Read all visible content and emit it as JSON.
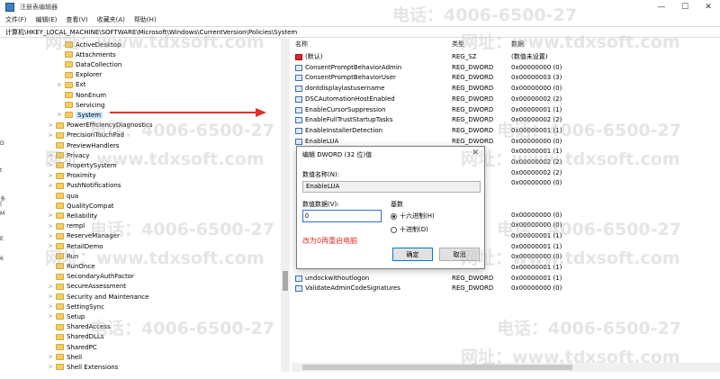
{
  "window": {
    "title": "注册表编辑器",
    "minimize": "—",
    "maximize": "☐",
    "close": "✕"
  },
  "menu": [
    "文件(F)",
    "编辑(E)",
    "查看(V)",
    "收藏夹(A)",
    "帮助(H)"
  ],
  "address": "计算机\\HKEY_LOCAL_MACHINE\\SOFTWARE\\Microsoft\\Windows\\CurrentVersion\\Policies\\System",
  "tree": {
    "items": [
      {
        "label": "ActiveDesktop",
        "expander": ""
      },
      {
        "label": "Attachments",
        "expander": ""
      },
      {
        "label": "DataCollection",
        "expander": ""
      },
      {
        "label": "Explorer",
        "expander": ""
      },
      {
        "label": "Ext",
        "expander": ">"
      },
      {
        "label": "NonEnum",
        "expander": ""
      },
      {
        "label": "Servicing",
        "expander": ""
      },
      {
        "label": "System",
        "expander": ">"
      },
      {
        "label": "PowerEfficiencyDiagnostics",
        "expander": ">"
      },
      {
        "label": "PrecisionTouchPad",
        "expander": ">"
      },
      {
        "label": "PreviewHandlers",
        "expander": ""
      },
      {
        "label": "Privacy",
        "expander": ">"
      },
      {
        "label": "PropertySystem",
        "expander": ">"
      },
      {
        "label": "Proximity",
        "expander": ">"
      },
      {
        "label": "PushNotifications",
        "expander": ">"
      },
      {
        "label": "qua",
        "expander": ""
      },
      {
        "label": "QualityCompat",
        "expander": ""
      },
      {
        "label": "Reliability",
        "expander": ">"
      },
      {
        "label": "rempl",
        "expander": ">"
      },
      {
        "label": "ReserveManager",
        "expander": ">"
      },
      {
        "label": "RetailDemo",
        "expander": ">"
      },
      {
        "label": "Run",
        "expander": ""
      },
      {
        "label": "RunOnce",
        "expander": ""
      },
      {
        "label": "SecondaryAuthFactor",
        "expander": ""
      },
      {
        "label": "SecureAssessment",
        "expander": ">"
      },
      {
        "label": "Security and Maintenance",
        "expander": ">"
      },
      {
        "label": "SettingSync",
        "expander": ">"
      },
      {
        "label": "Setup",
        "expander": ">"
      },
      {
        "label": "SharedAccess",
        "expander": ""
      },
      {
        "label": "SharedDLLs",
        "expander": ""
      },
      {
        "label": "SharedPC",
        "expander": ""
      },
      {
        "label": "Shell",
        "expander": ">"
      },
      {
        "label": "Shell Extensions",
        "expander": ">"
      },
      {
        "label": "ShellCompatibility",
        "expander": ">"
      }
    ],
    "selected_index": 7
  },
  "left_edge_chars": [
    "D",
    "t",
    "多",
    "(",
    "M",
    "E",
    "6"
  ],
  "list": {
    "headers": {
      "name": "名称",
      "type": "类型",
      "data": "数据"
    },
    "rows": [
      {
        "name": "(默认)",
        "type": "REG_SZ",
        "data": "(数值未设置)",
        "icon": "sz"
      },
      {
        "name": "ConsentPromptBehaviorAdmin",
        "type": "REG_DWORD",
        "data": "0x00000000 (0)",
        "icon": "dword"
      },
      {
        "name": "ConsentPromptBehaviorUser",
        "type": "REG_DWORD",
        "data": "0x00000003 (3)",
        "icon": "dword"
      },
      {
        "name": "dontdisplaylastusername",
        "type": "REG_DWORD",
        "data": "0x00000000 (0)",
        "icon": "dword"
      },
      {
        "name": "DSCAutomationHostEnabled",
        "type": "REG_DWORD",
        "data": "0x00000002 (2)",
        "icon": "dword"
      },
      {
        "name": "EnableCursorSuppression",
        "type": "REG_DWORD",
        "data": "0x00000001 (1)",
        "icon": "dword"
      },
      {
        "name": "EnableFullTrustStartupTasks",
        "type": "REG_DWORD",
        "data": "0x00000002 (2)",
        "icon": "dword"
      },
      {
        "name": "EnableInstallerDetection",
        "type": "REG_DWORD",
        "data": "0x00000001 (1)",
        "icon": "dword"
      },
      {
        "name": "EnableLUA",
        "type": "REG_DWORD",
        "data": "0x00000000 (0)",
        "icon": "dword"
      },
      {
        "name": "",
        "type": "",
        "data": "0x00000001 (1)",
        "icon": "none"
      },
      {
        "name": "",
        "type": "",
        "data": "0x00000002 (2)",
        "icon": "none"
      },
      {
        "name": "",
        "type": "",
        "data": "0x00000002 (2)",
        "icon": "none"
      },
      {
        "name": "",
        "type": "",
        "data": "0x00000000 (0)",
        "icon": "none"
      },
      {
        "name": "",
        "type": "",
        "data": "",
        "icon": "none"
      },
      {
        "name": "",
        "type": "",
        "data": "",
        "icon": "none"
      },
      {
        "name": "",
        "type": "",
        "data": "0x00000000 (0)",
        "icon": "none"
      },
      {
        "name": "",
        "type": "",
        "data": "0x00000000 (0)",
        "icon": "none"
      },
      {
        "name": "",
        "type": "",
        "data": "0x00000001 (1)",
        "icon": "none"
      },
      {
        "name": "",
        "type": "",
        "data": "0x00000001 (1)",
        "icon": "none"
      },
      {
        "name": "",
        "type": "",
        "data": "0x00000000 (0)",
        "icon": "none"
      },
      {
        "name": "",
        "type": "",
        "data": "0x00000001 (1)",
        "icon": "none"
      },
      {
        "name": "undockwithoutlogon",
        "type": "REG_DWORD",
        "data": "0x00000001 (1)",
        "icon": "dword"
      },
      {
        "name": "ValidateAdminCodeSignatures",
        "type": "REG_DWORD",
        "data": "0x00000000 (0)",
        "icon": "dword"
      }
    ]
  },
  "dialog": {
    "title": "编辑 DWORD (32 位)值",
    "close": "✕",
    "name_label": "数值名称(N):",
    "name_value": "EnableLUA",
    "value_label": "数值数据(V):",
    "value": "0",
    "base_label": "基数",
    "hex_label": "十六进制(H)",
    "dec_label": "十进制(D)",
    "note": "改为0再重启电脑",
    "ok": "确定",
    "cancel": "取消"
  },
  "watermarks": {
    "phone": "电话：4006-6500-27",
    "site": "网址：www.tdxsoft.com"
  },
  "colors": {
    "selection": "#cce8ff",
    "arrow": "#e0302a",
    "note": "#e0302a",
    "focus": "#0078d7"
  }
}
